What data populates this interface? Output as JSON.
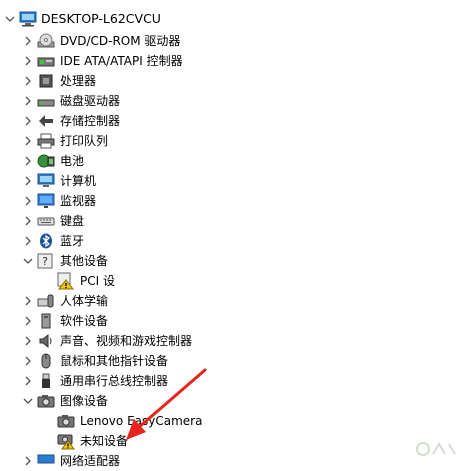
{
  "tree": {
    "root": {
      "label": "DESKTOP-L62CVCU",
      "icon": "computer-icon",
      "expanded": true
    },
    "items": [
      {
        "label": "DVD/CD-ROM 驱动器",
        "icon": "dvd-drive-icon",
        "expanded": false
      },
      {
        "label": "IDE ATA/ATAPI 控制器",
        "icon": "ide-controller-icon",
        "expanded": false
      },
      {
        "label": "处理器",
        "icon": "processor-icon",
        "expanded": false
      },
      {
        "label": "磁盘驱动器",
        "icon": "disk-drive-icon",
        "expanded": false
      },
      {
        "label": "存储控制器",
        "icon": "storage-controller-icon",
        "expanded": false
      },
      {
        "label": "打印队列",
        "icon": "printer-icon",
        "expanded": false
      },
      {
        "label": "电池",
        "icon": "battery-icon",
        "expanded": false
      },
      {
        "label": "计算机",
        "icon": "monitor-icon",
        "expanded": false
      },
      {
        "label": "监视器",
        "icon": "display-icon",
        "expanded": false
      },
      {
        "label": "键盘",
        "icon": "keyboard-icon",
        "expanded": false
      },
      {
        "label": "蓝牙",
        "icon": "bluetooth-icon",
        "expanded": false
      },
      {
        "label": "其他设备",
        "icon": "unknown-device-icon",
        "expanded": true,
        "children": [
          {
            "label": "PCI 设",
            "icon": "warning-device-icon"
          }
        ]
      },
      {
        "label": "人体学输",
        "icon": "hid-icon",
        "expanded": false
      },
      {
        "label": "软件设备",
        "icon": "software-device-icon",
        "expanded": false
      },
      {
        "label": "声音、视频和游戏控制器",
        "icon": "speaker-icon",
        "expanded": false
      },
      {
        "label": "鼠标和其他指针设备",
        "icon": "mouse-icon",
        "expanded": false
      },
      {
        "label": "通用串行总线控制器",
        "icon": "usb-icon",
        "expanded": false
      },
      {
        "label": "图像设备",
        "icon": "camera-icon",
        "expanded": true,
        "children": [
          {
            "label": "Lenovo EasyCamera",
            "icon": "camera-icon"
          },
          {
            "label": "未知设备",
            "icon": "warning-camera-icon"
          }
        ]
      },
      {
        "label": "网络适配器",
        "icon": "network-adapter-icon",
        "expanded": false
      }
    ]
  },
  "colors": {
    "arrow": "#e8251c",
    "warning": "#f5c400",
    "chevron": "#555555"
  }
}
